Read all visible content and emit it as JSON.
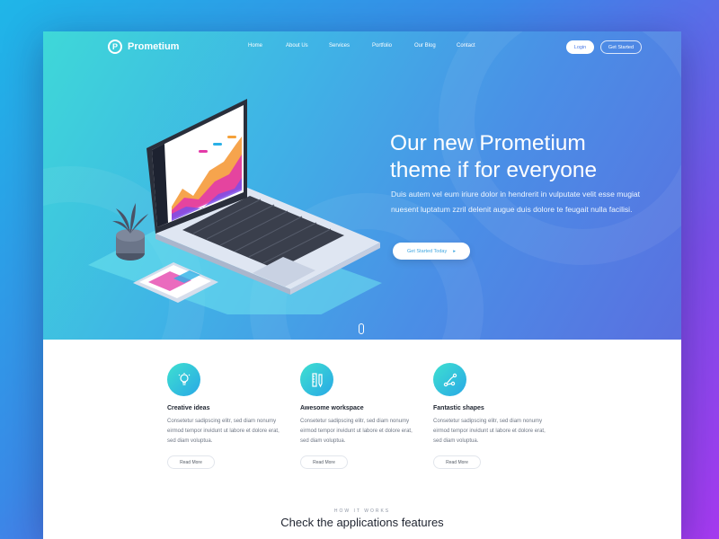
{
  "brand": {
    "name": "Prometium",
    "mark": "P"
  },
  "nav": {
    "links": [
      "Home",
      "About Us",
      "Services",
      "Portfolio",
      "Our Blog",
      "Contact"
    ],
    "login_label": "Login",
    "get_started_label": "Get Started"
  },
  "hero": {
    "title_line1": "Our new Prometium",
    "title_line2": "theme if for everyone",
    "description": "Duis autem vel eum iriure dolor in hendrerit in vulputate velit esse mugiat nuesent luptatum zzril delenit augue duis dolore te feugait nulla facilisi.",
    "cta_label": "Get Started Today",
    "cta_arrow": "▸"
  },
  "features": [
    {
      "title": "Creative ideas",
      "text": "Consetetur sadipscing elitr, sed diam nonumy eirmod tempor invidunt ut labore et dolore erat, sed diam voluptua.",
      "button": "Read More",
      "icon": "lightbulb-icon"
    },
    {
      "title": "Awesome workspace",
      "text": "Consetetur sadipscing elitr, sed diam nonumy eirmod tempor invidunt ut labore et dolore erat, sed diam voluptua.",
      "button": "Read More",
      "icon": "pencil-ruler-icon"
    },
    {
      "title": "Fantastic shapes",
      "text": "Consetetur sadipscing elitr, sed diam nonumy eirmod tempor invidunt ut labore et dolore erat, sed diam voluptua.",
      "button": "Read More",
      "icon": "vector-pen-icon"
    }
  ],
  "how_it_works": {
    "eyebrow": "HOW IT WORKS",
    "title": "Check the applications features"
  },
  "colors": {
    "accent": "#29a8e6",
    "accent_light": "#3ee0d0",
    "chart_pink": "#e83aa8",
    "chart_orange": "#f5a13a"
  }
}
